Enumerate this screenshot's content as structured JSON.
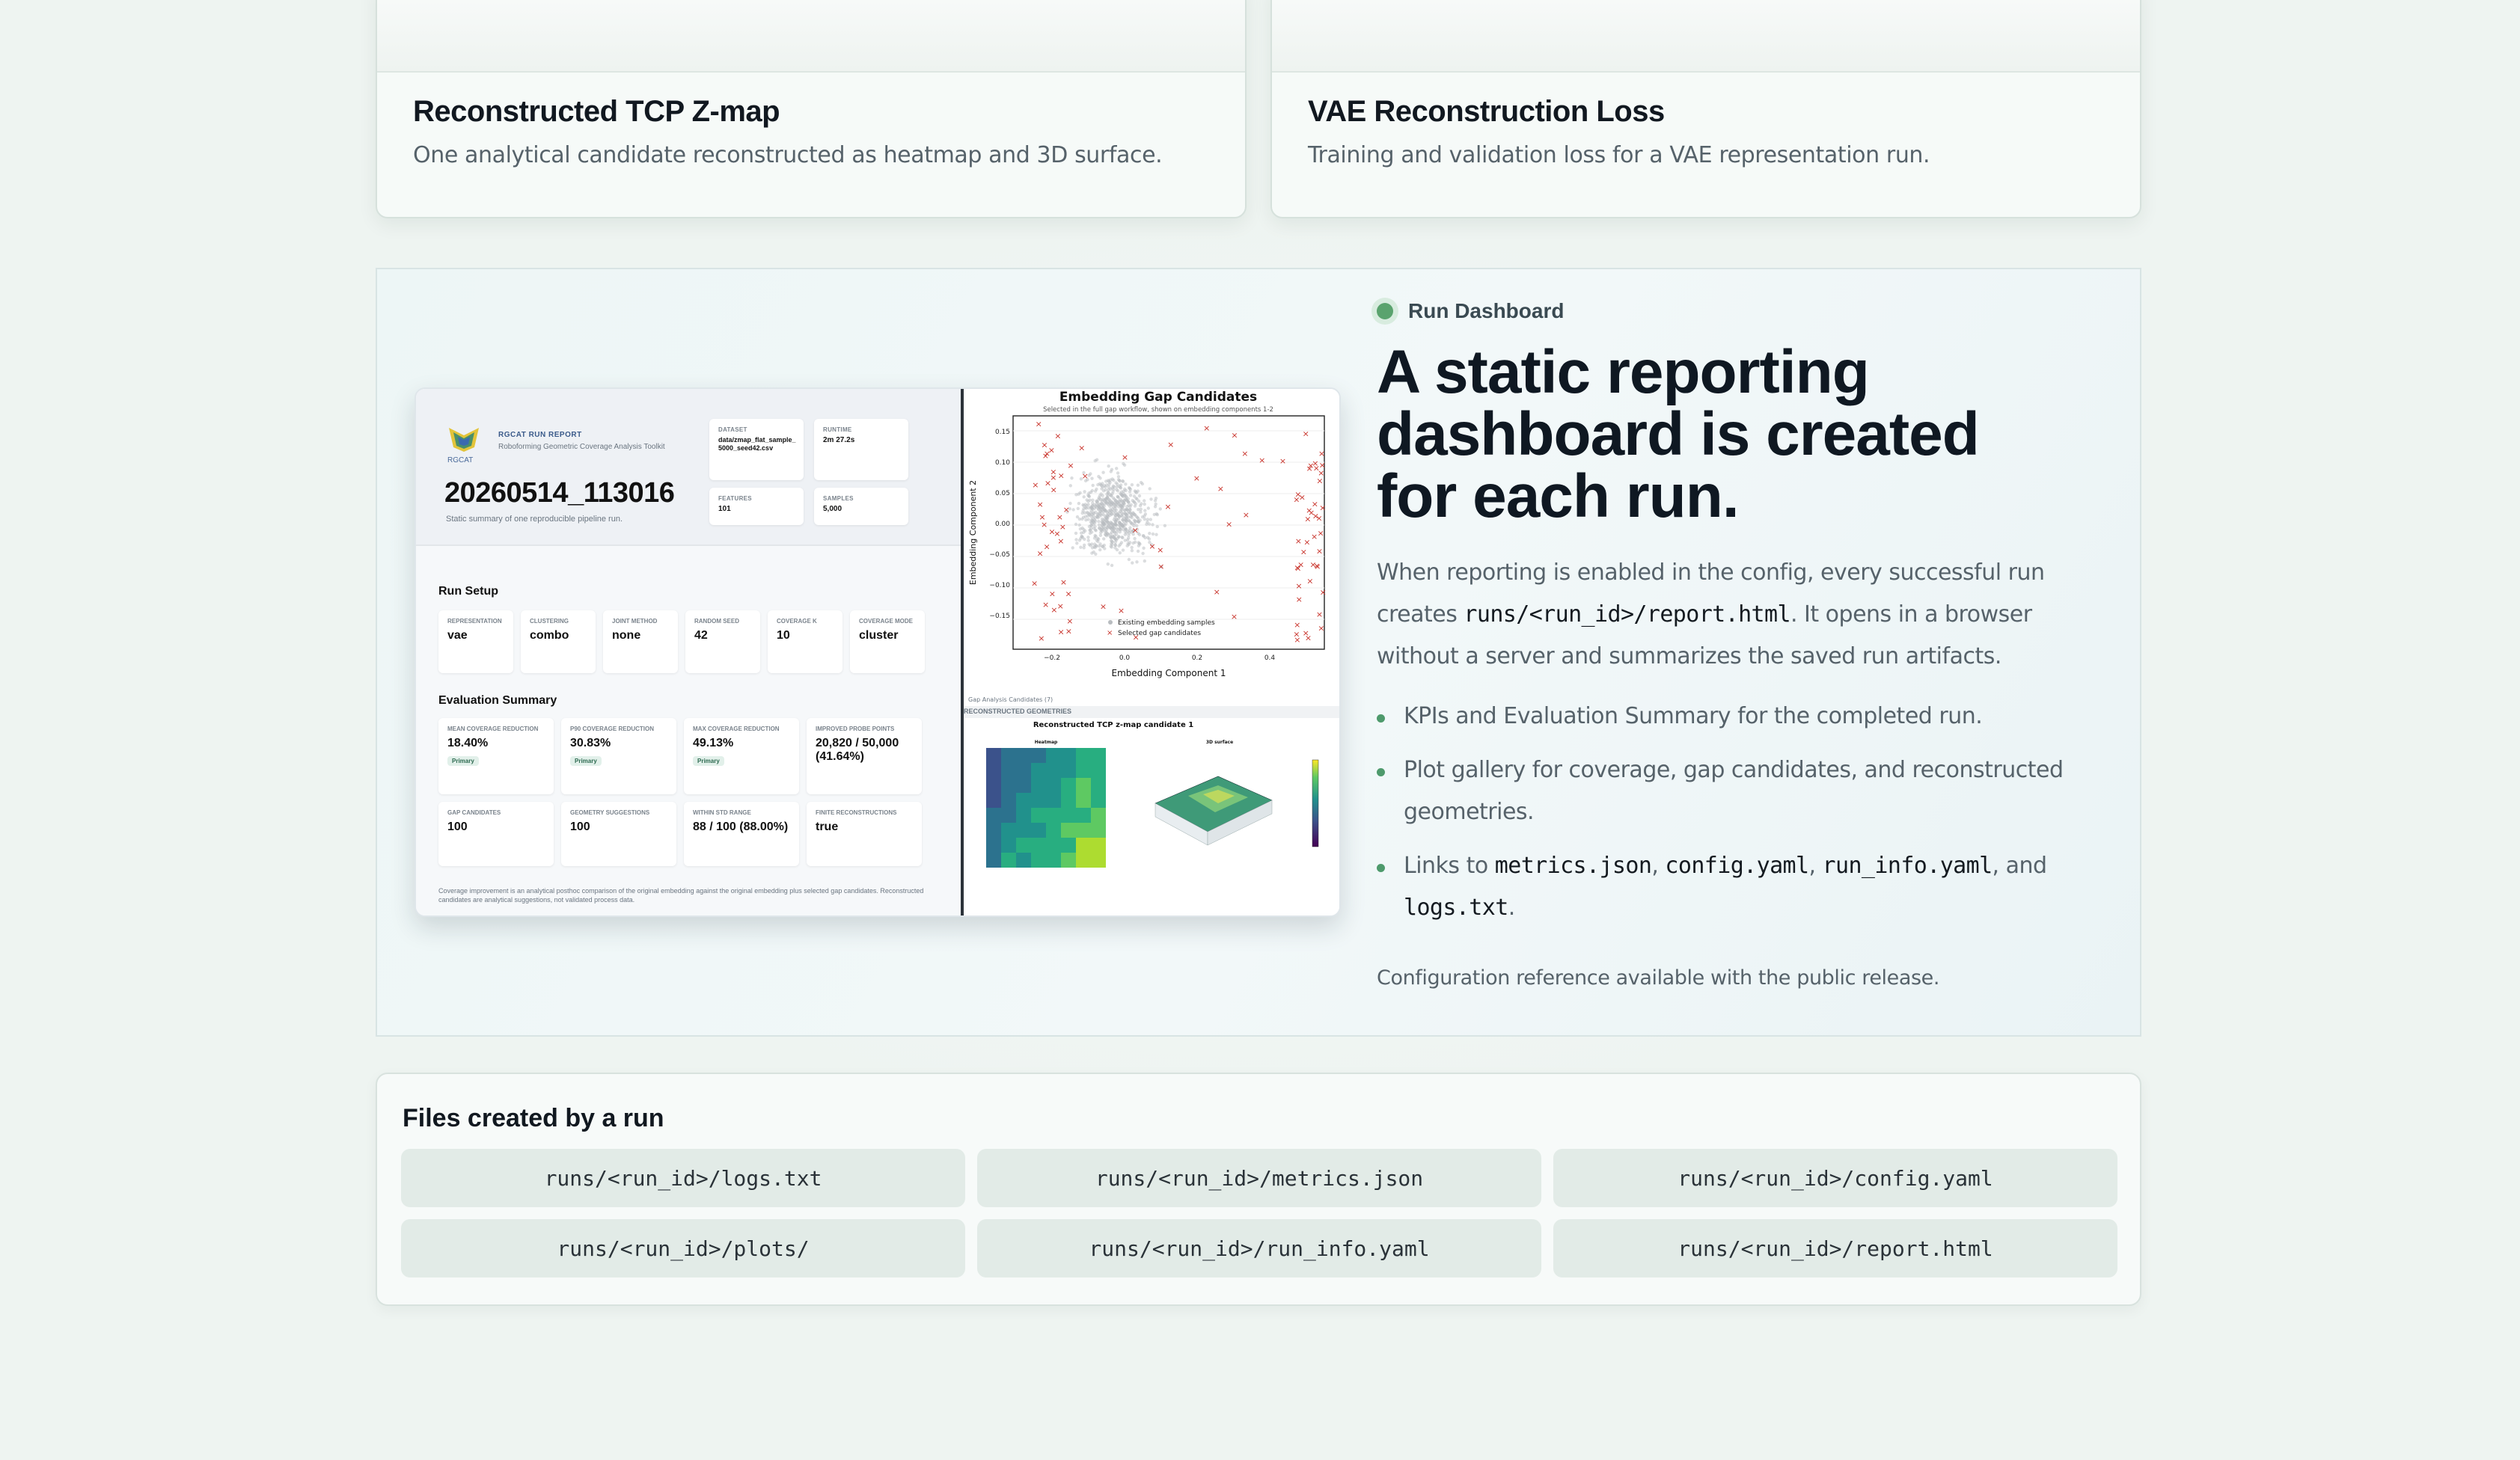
{
  "cards": [
    {
      "title": "Reconstructed TCP Z-map",
      "desc": "One analytical candidate reconstructed as heatmap and 3D surface."
    },
    {
      "title": "VAE Reconstruction Loss",
      "desc": "Training and validation loss for a VAE representation run."
    }
  ],
  "dashboard": {
    "badge": "Run Dashboard",
    "title": "A static reporting dashboard is created for each run.",
    "desc_pre": "When reporting is enabled in the config, every successful run creates",
    "desc_code": "runs/<run_id>/report.html",
    "desc_post": ". It opens in a browser without a server and summarizes the saved run artifacts.",
    "bullets": {
      "b1": "KPIs and Evaluation Summary for the completed run.",
      "b2": "Plot gallery for coverage, gap candidates, and reconstructed geometries.",
      "b3_pre": "Links to",
      "b3_c1": "metrics.json",
      "b3_c2": "config.yaml",
      "b3_c3": "run_info.yaml",
      "b3_and": ", and",
      "b3_c4": "logs.txt",
      "b3_end": "."
    },
    "note": "Configuration reference available with the public release."
  },
  "report": {
    "brand": "RGCAT RUN REPORT",
    "brand_sub": "Roboforming Geometric Coverage Analysis Toolkit",
    "logo_text": "RGCAT",
    "run_id": "20260514_113016",
    "subtitle": "Static summary of one reproducible pipeline run.",
    "meta": [
      {
        "k": "Dataset",
        "v": "data/zmap_flat_sample_5000_seed42.csv"
      },
      {
        "k": "Runtime",
        "v": "2m 27.2s"
      },
      {
        "k": "Features",
        "v": "101"
      },
      {
        "k": "Samples",
        "v": "5,000"
      }
    ],
    "setup_title": "Run Setup",
    "setup": [
      {
        "k": "Representation",
        "v": "vae"
      },
      {
        "k": "Clustering",
        "v": "combo"
      },
      {
        "k": "Joint Method",
        "v": "none"
      },
      {
        "k": "Random Seed",
        "v": "42"
      },
      {
        "k": "Coverage K",
        "v": "10"
      },
      {
        "k": "Coverage Mode",
        "v": "cluster"
      }
    ],
    "eval_title": "Evaluation Summary",
    "eval": [
      {
        "k": "Mean Coverage Reduction",
        "v": "18.40%",
        "pill": "Primary"
      },
      {
        "k": "P90 Coverage Reduction",
        "v": "30.83%",
        "pill": "Primary"
      },
      {
        "k": "Max Coverage Reduction",
        "v": "49.13%",
        "pill": "Primary"
      },
      {
        "k": "Improved Probe Points",
        "v": "20,820 / 50,000 (41.64%)",
        "pill": ""
      },
      {
        "k": "Gap Candidates",
        "v": "100",
        "pill": ""
      },
      {
        "k": "Geometry Suggestions",
        "v": "100",
        "pill": ""
      },
      {
        "k": "Within STD Range",
        "v": "88 / 100 (88.00%)",
        "pill": ""
      },
      {
        "k": "Finite Reconstructions",
        "v": "true",
        "pill": ""
      }
    ],
    "footnote": "Coverage improvement is an analytical posthoc comparison of the original embedding against the original embedding plus selected gap candidates. Reconstructed candidates are analytical suggestions, not validated process data.",
    "plot1": {
      "title": "Embedding Gap Candidates",
      "subtitle": "Selected in the full gap workflow, shown on embedding components 1-2",
      "xlabel": "Embedding Component 1",
      "ylabel": "Embedding Component 2",
      "legend_a": "Existing embedding samples",
      "legend_b": "Selected gap candidates",
      "caption": "Gap Analysis Candidates (7)",
      "yticks": [
        "0.15",
        "0.10",
        "0.05",
        "0.00",
        "−0.05",
        "−0.10",
        "−0.15"
      ],
      "xticks": [
        "−0.2",
        "0.0",
        "0.2",
        "0.4"
      ]
    },
    "plot2": {
      "section": "RECONSTRUCTED GEOMETRIES",
      "title": "Reconstructed TCP z-map candidate 1",
      "heatmap_label": "Heatmap",
      "surface_label": "3D surface"
    }
  },
  "files": {
    "title": "Files created by a run",
    "items": [
      "runs/<run_id>/logs.txt",
      "runs/<run_id>/metrics.json",
      "runs/<run_id>/config.yaml",
      "runs/<run_id>/plots/",
      "runs/<run_id>/run_info.yaml",
      "runs/<run_id>/report.html"
    ]
  },
  "colors": {
    "accent": "#5aa36e",
    "candidate": "#c8322a",
    "sample": "#b8bcc0"
  }
}
